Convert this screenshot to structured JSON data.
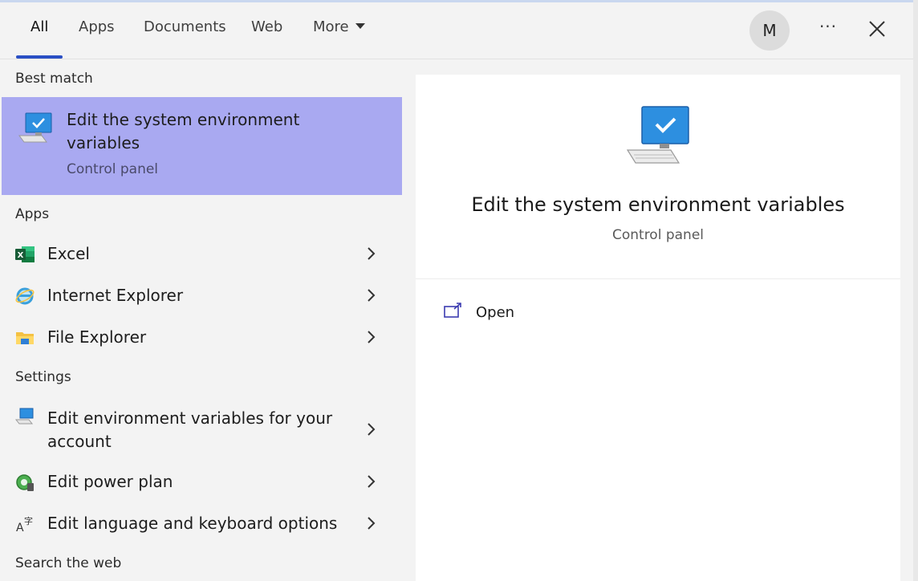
{
  "header": {
    "tabs": [
      {
        "label": "All",
        "active": true
      },
      {
        "label": "Apps"
      },
      {
        "label": "Documents"
      },
      {
        "label": "Web"
      },
      {
        "label": "More"
      }
    ],
    "avatar_initial": "M",
    "more_options_label": "···",
    "accent_color": "#2a4fc4"
  },
  "results": {
    "best_match_header": "Best match",
    "best_match": {
      "title": "Edit the system environment variables",
      "subtitle": "Control panel",
      "icon": "monitor-check-icon",
      "highlight_color": "#a9a9f1"
    },
    "apps_header": "Apps",
    "apps": [
      {
        "label": "Excel",
        "icon": "excel-icon"
      },
      {
        "label": "Internet Explorer",
        "icon": "internet-explorer-icon"
      },
      {
        "label": "File Explorer",
        "icon": "folder-icon"
      }
    ],
    "settings_header": "Settings",
    "settings": [
      {
        "label": "Edit environment variables for your account",
        "icon": "env-settings-icon"
      },
      {
        "label": "Edit power plan",
        "icon": "power-plan-icon"
      },
      {
        "label": "Edit language and keyboard options",
        "icon": "language-icon"
      }
    ],
    "search_web_header": "Search the web"
  },
  "detail": {
    "title": "Edit the system environment variables",
    "subtitle": "Control panel",
    "icon": "monitor-check-icon",
    "actions": [
      {
        "label": "Open",
        "icon": "open-icon"
      }
    ]
  }
}
